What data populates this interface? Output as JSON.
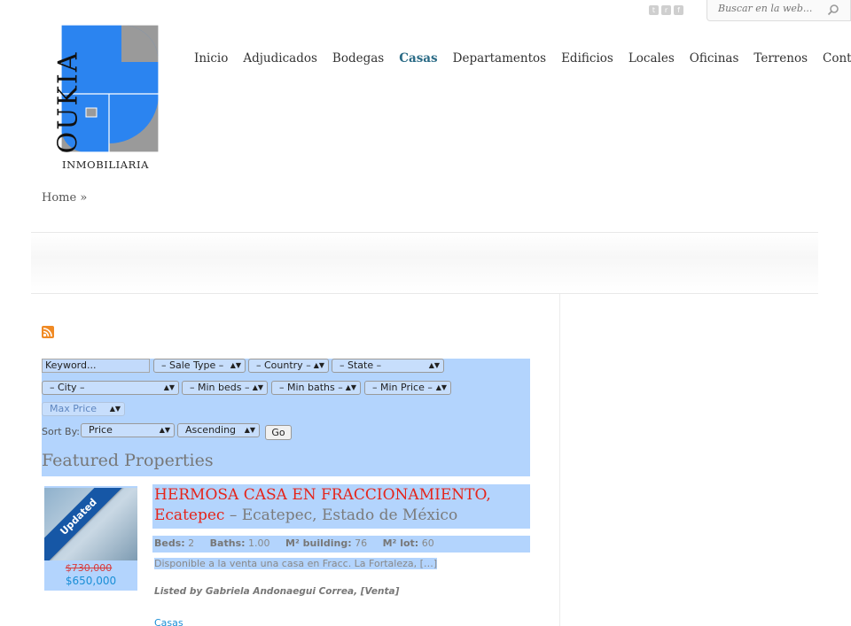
{
  "header": {
    "search_placeholder": "Buscar en la web...",
    "social": [
      {
        "icon": "twitter-icon",
        "glyph": "t"
      },
      {
        "icon": "rss-icon",
        "glyph": "r"
      },
      {
        "icon": "facebook-icon",
        "glyph": "f"
      }
    ]
  },
  "logo": {
    "name": "OUKIA",
    "tagline": "INMOBILIARIA",
    "colors": {
      "blue": "#2b84f0",
      "gray": "#9a9a9a"
    }
  },
  "nav": {
    "items": [
      "Inicio",
      "Adjudicados",
      "Bodegas",
      "Casas",
      "Departamentos",
      "Edificios",
      "Locales",
      "Oficinas",
      "Terrenos",
      "Contacto"
    ],
    "active": "Casas"
  },
  "breadcrumb": {
    "home": "Home",
    "sep": "»"
  },
  "filters": {
    "keyword": "Keyword...",
    "sale_type": "– Sale Type –",
    "country": "– Country –",
    "state": "– State –",
    "city": "– City –",
    "min_beds": "– Min beds –",
    "min_baths": "– Min baths –",
    "min_price": "– Min Price –",
    "max_price": "Max Price",
    "sort_by_label": "Sort By:",
    "sort_field": "Price",
    "sort_order": "Ascending",
    "go_label": "Go"
  },
  "featured_title": "Featured Properties",
  "listing": {
    "badge": "Updated",
    "old_price": "$730,000",
    "price": "$650,000",
    "title_red": "HERMOSA CASA EN FRACCIONAMIENTO, Ecatepec",
    "title_loc": " – Ecatepec, Estado de México",
    "beds_label": "Beds:",
    "beds": "2",
    "baths_label": "Baths:",
    "baths": "1.00",
    "building_label": "M² building:",
    "building": "76",
    "lot_label": "M² lot:",
    "lot": "60",
    "description": "Disponible a la venta una casa en Fracc. La Fortaleza, […]",
    "listed_by": "Listed by Gabriela Andonaegui Correa, [Venta]",
    "category": "Casas"
  }
}
